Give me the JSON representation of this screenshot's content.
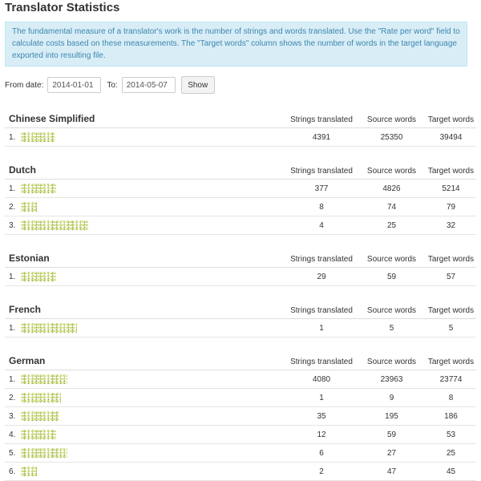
{
  "page": {
    "title": "Translator Statistics",
    "info": "The fundamental measure of a translator's work is the number of strings and words translated. Use the \"Rate per word\" field to calculate costs based on these measurements. The \"Target words\" column shows the number of words in the target language exported into resulting file."
  },
  "filters": {
    "from_label": "From date:",
    "from_value": "2014-01-01",
    "to_label": "To:",
    "to_value": "2014-05-07",
    "show_label": "Show"
  },
  "columns": {
    "strings": "Strings translated",
    "source": "Source words",
    "target": "Target words"
  },
  "languages": [
    {
      "name": "Chinese Simplified",
      "rows": [
        {
          "idx": "1.",
          "strings": "4391",
          "source": "25350",
          "target": "39494"
        }
      ]
    },
    {
      "name": "Dutch",
      "rows": [
        {
          "idx": "1.",
          "strings": "377",
          "source": "4826",
          "target": "5214"
        },
        {
          "idx": "2.",
          "strings": "8",
          "source": "74",
          "target": "79"
        },
        {
          "idx": "3.",
          "strings": "4",
          "source": "25",
          "target": "32"
        }
      ]
    },
    {
      "name": "Estonian",
      "rows": [
        {
          "idx": "1.",
          "strings": "29",
          "source": "59",
          "target": "57"
        }
      ]
    },
    {
      "name": "French",
      "rows": [
        {
          "idx": "1.",
          "strings": "1",
          "source": "5",
          "target": "5"
        }
      ]
    },
    {
      "name": "German",
      "rows": [
        {
          "idx": "1.",
          "strings": "4080",
          "source": "23963",
          "target": "23774"
        },
        {
          "idx": "2.",
          "strings": "1",
          "source": "9",
          "target": "8"
        },
        {
          "idx": "3.",
          "strings": "35",
          "source": "195",
          "target": "186"
        },
        {
          "idx": "4.",
          "strings": "12",
          "source": "59",
          "target": "53"
        },
        {
          "idx": "5.",
          "strings": "6",
          "source": "27",
          "target": "25"
        },
        {
          "idx": "6.",
          "strings": "2",
          "source": "47",
          "target": "45"
        }
      ]
    }
  ]
}
